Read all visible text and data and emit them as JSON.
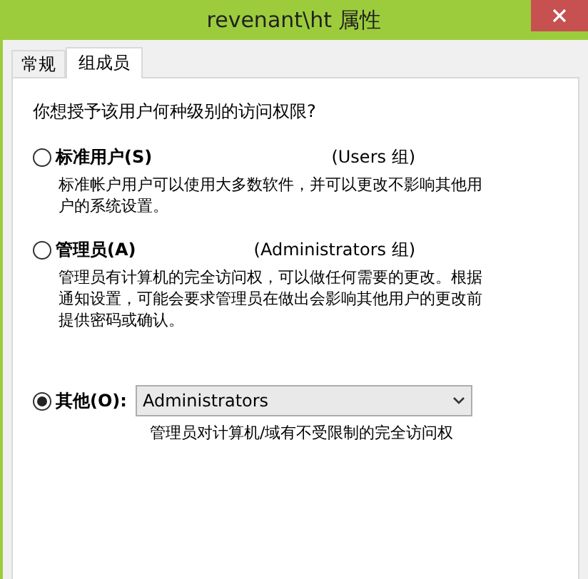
{
  "window": {
    "title": "revenant\\ht 属性"
  },
  "tabs": [
    {
      "label": "常规",
      "selected": false
    },
    {
      "label": "组成员",
      "selected": true
    }
  ],
  "question": "你想授予该用户何种级别的访问权限?",
  "options": [
    {
      "kind": "plain",
      "label": "标准用户(S)",
      "group": "(Users 组)",
      "description": "标准帐户用户可以使用大多数软件，并可以更改不影响其他用户的系统设置。",
      "selected": false
    },
    {
      "kind": "plain",
      "label": "管理员(A)",
      "group": "(Administrators 组)",
      "description": "管理员有计算机的完全访问权，可以做任何需要的更改。根据通知设置，可能会要求管理员在做出会影响其他用户的更改前提供密码或确认。",
      "selected": false
    },
    {
      "kind": "select",
      "label": "其他(O):",
      "value": "Administrators",
      "description": "管理员对计算机/域有不受限制的完全访问权",
      "selected": true
    }
  ]
}
